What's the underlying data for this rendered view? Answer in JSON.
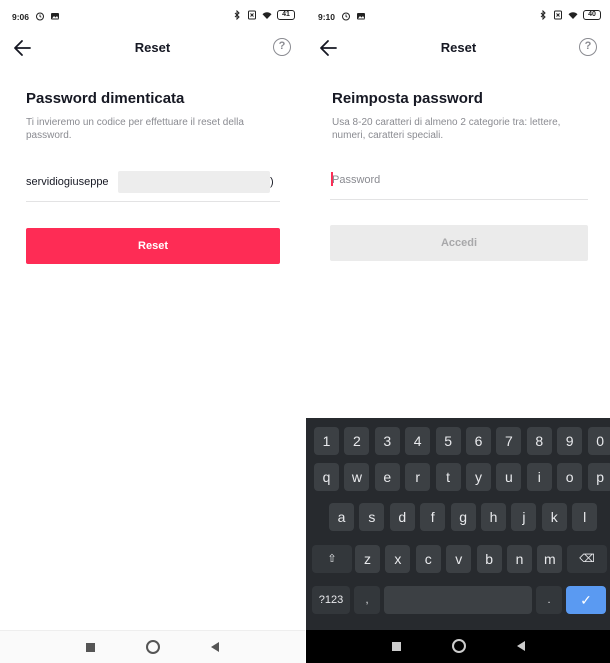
{
  "left_screen": {
    "status_bar": {
      "time": "9:06",
      "battery": "41"
    },
    "header": {
      "title": "Reset",
      "help_label": "?"
    },
    "heading": "Password dimenticata",
    "description": "Ti invieremo un codice per effettuare il reset della password.",
    "email_field": {
      "value": "servidiogiuseppe",
      "trailing": ")"
    },
    "reset_button_label": "Reset"
  },
  "right_screen": {
    "status_bar": {
      "time": "9:10",
      "battery": "40"
    },
    "header": {
      "title": "Reset",
      "help_label": "?"
    },
    "heading": "Reimposta password",
    "description": "Usa 8-20 caratteri di almeno 2 categorie tra: lettere, numeri, caratteri speciali.",
    "password_field": {
      "placeholder": "Password",
      "value": ""
    },
    "accedi_button_label": "Accedi",
    "keyboard": {
      "row1": [
        "1",
        "2",
        "3",
        "4",
        "5",
        "6",
        "7",
        "8",
        "9",
        "0"
      ],
      "row2": [
        "q",
        "w",
        "e",
        "r",
        "t",
        "y",
        "u",
        "i",
        "o",
        "p"
      ],
      "row3": [
        "a",
        "s",
        "d",
        "f",
        "g",
        "h",
        "j",
        "k",
        "l"
      ],
      "row4": [
        "z",
        "x",
        "c",
        "v",
        "b",
        "n",
        "m"
      ],
      "shift_symbol": "⇧",
      "backspace_symbol": "⌫",
      "symbols_label": "?123",
      "comma": ",",
      "period": ".",
      "enter_symbol": "✓"
    }
  },
  "colors": {
    "accent": "#fe2c55",
    "disabled_button": "#ebebeb",
    "keyboard_bg": "#272a2e",
    "key_bg": "#3c4044",
    "enter_key": "#5a9af2"
  }
}
